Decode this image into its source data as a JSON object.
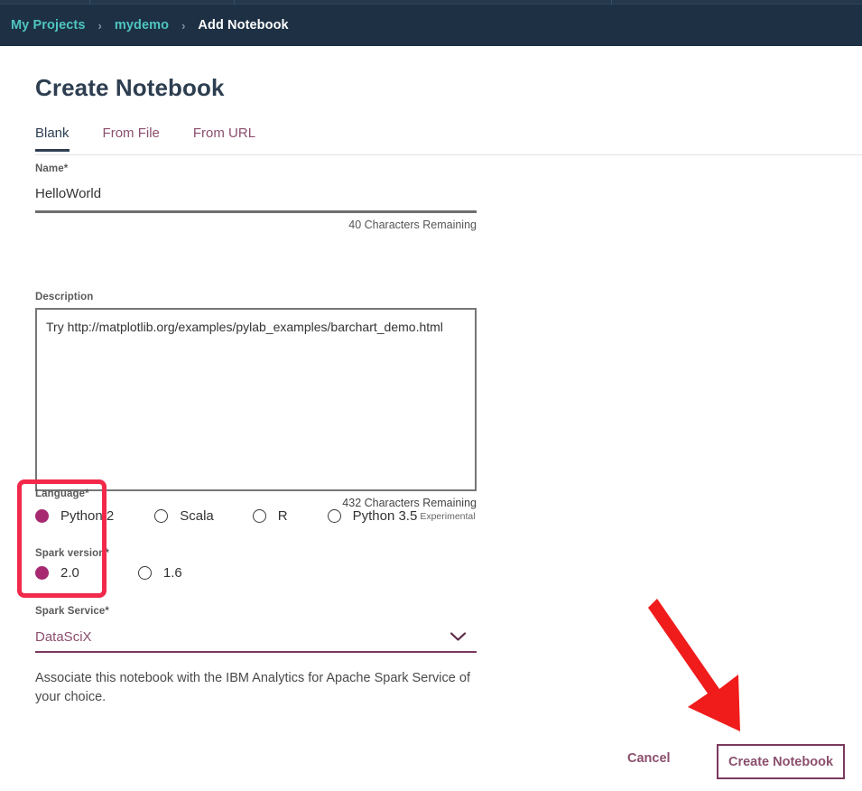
{
  "header": {
    "breadcrumb": [
      {
        "label": "My Projects",
        "current": false
      },
      {
        "label": "mydemo",
        "current": false
      },
      {
        "label": "Add Notebook",
        "current": true
      }
    ],
    "separator": "›",
    "background": "#1d3044",
    "link_color": "#4fc6c0"
  },
  "page": {
    "title": "Create Notebook",
    "accent_color": "#8b4f6e",
    "selected_color": "#a72a70"
  },
  "tabs": [
    {
      "label": "Blank",
      "active": true
    },
    {
      "label": "From File",
      "active": false
    },
    {
      "label": "From URL",
      "active": false
    }
  ],
  "form": {
    "name": {
      "label": "Name*",
      "value": "HelloWorld",
      "placeholder": "",
      "counter": "40 Characters Remaining"
    },
    "description": {
      "label": "Description",
      "value": "Try http://matplotlib.org/examples/pylab_examples/barchart_demo.html",
      "placeholder": "",
      "counter": "432 Characters Remaining"
    },
    "language": {
      "label": "Language*",
      "options": [
        {
          "label": "Python 2",
          "selected": true,
          "superscript": ""
        },
        {
          "label": "Scala",
          "selected": false,
          "superscript": ""
        },
        {
          "label": "R",
          "selected": false,
          "superscript": ""
        },
        {
          "label": "Python 3.5",
          "selected": false,
          "superscript": "Experimental"
        }
      ]
    },
    "spark_version": {
      "label": "Spark version*",
      "options": [
        {
          "label": "2.0",
          "selected": true
        },
        {
          "label": "1.6",
          "selected": false
        }
      ]
    },
    "spark_service": {
      "label": "Spark Service*",
      "value": "DataSciX",
      "icon": "chevron-down-icon",
      "helper_text": "Associate this notebook with the IBM Analytics for Apache Spark Service of your choice."
    }
  },
  "footer": {
    "cancel_label": "Cancel",
    "create_label": "Create Notebook"
  },
  "annotations": {
    "highlight_box_color": "#f2294a",
    "arrow_color": "#f01b1b",
    "arrow_target": "Create Notebook"
  }
}
